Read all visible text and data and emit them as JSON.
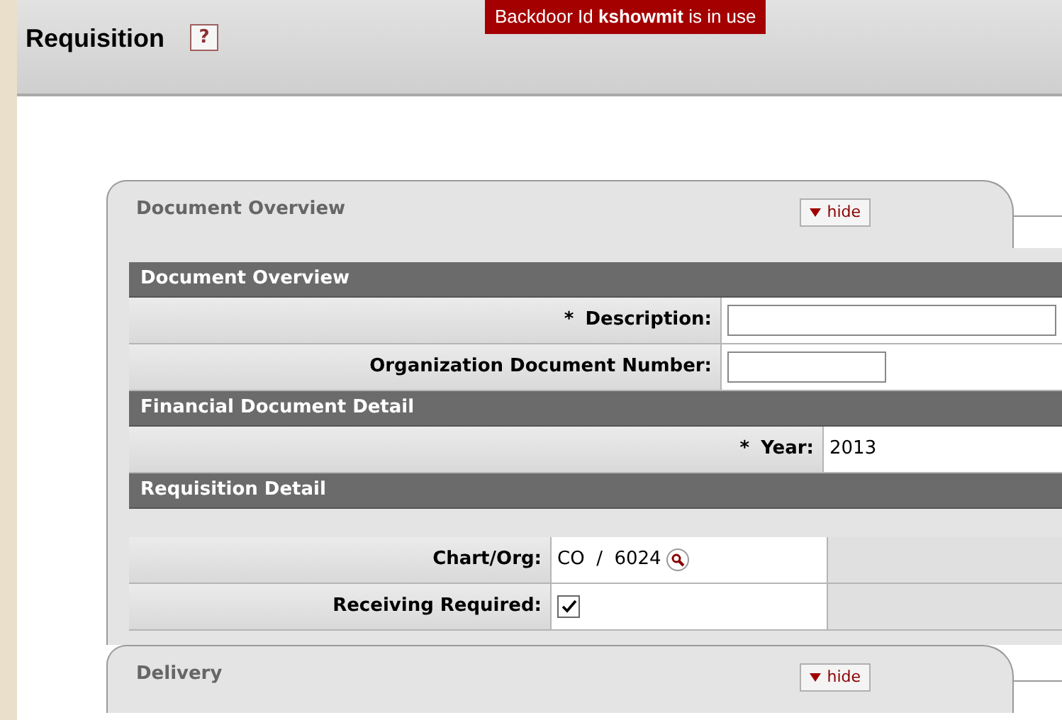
{
  "page_title": "Requisition",
  "help_button": "?",
  "banner": "Backdoor Id **kshowmit** is in use",
  "tabs": [
    {
      "title": "Document Overview",
      "hide_button": "hide"
    },
    {
      "title": "Delivery",
      "hide_button": "hide"
    }
  ],
  "sections": [
    {
      "header": "Document Overview",
      "fields": [
        {
          "kind": "text",
          "required_mark": "*",
          "label": "Description:"
        },
        {
          "kind": "short_text",
          "label": "Organization Document Number:"
        }
      ]
    },
    {
      "header": "Financial Document Detail",
      "fields": [
        {
          "kind": "static",
          "required_mark": "*",
          "label": "Year:",
          "value": "2013"
        }
      ]
    },
    {
      "header": "Requisition Detail",
      "fields": [
        {
          "kind": "lookup",
          "label": "Chart/Org:",
          "value": "CO  /  6024"
        },
        {
          "kind": "checkbox",
          "label": "Receiving Required:",
          "checked": true
        }
      ]
    }
  ]
}
